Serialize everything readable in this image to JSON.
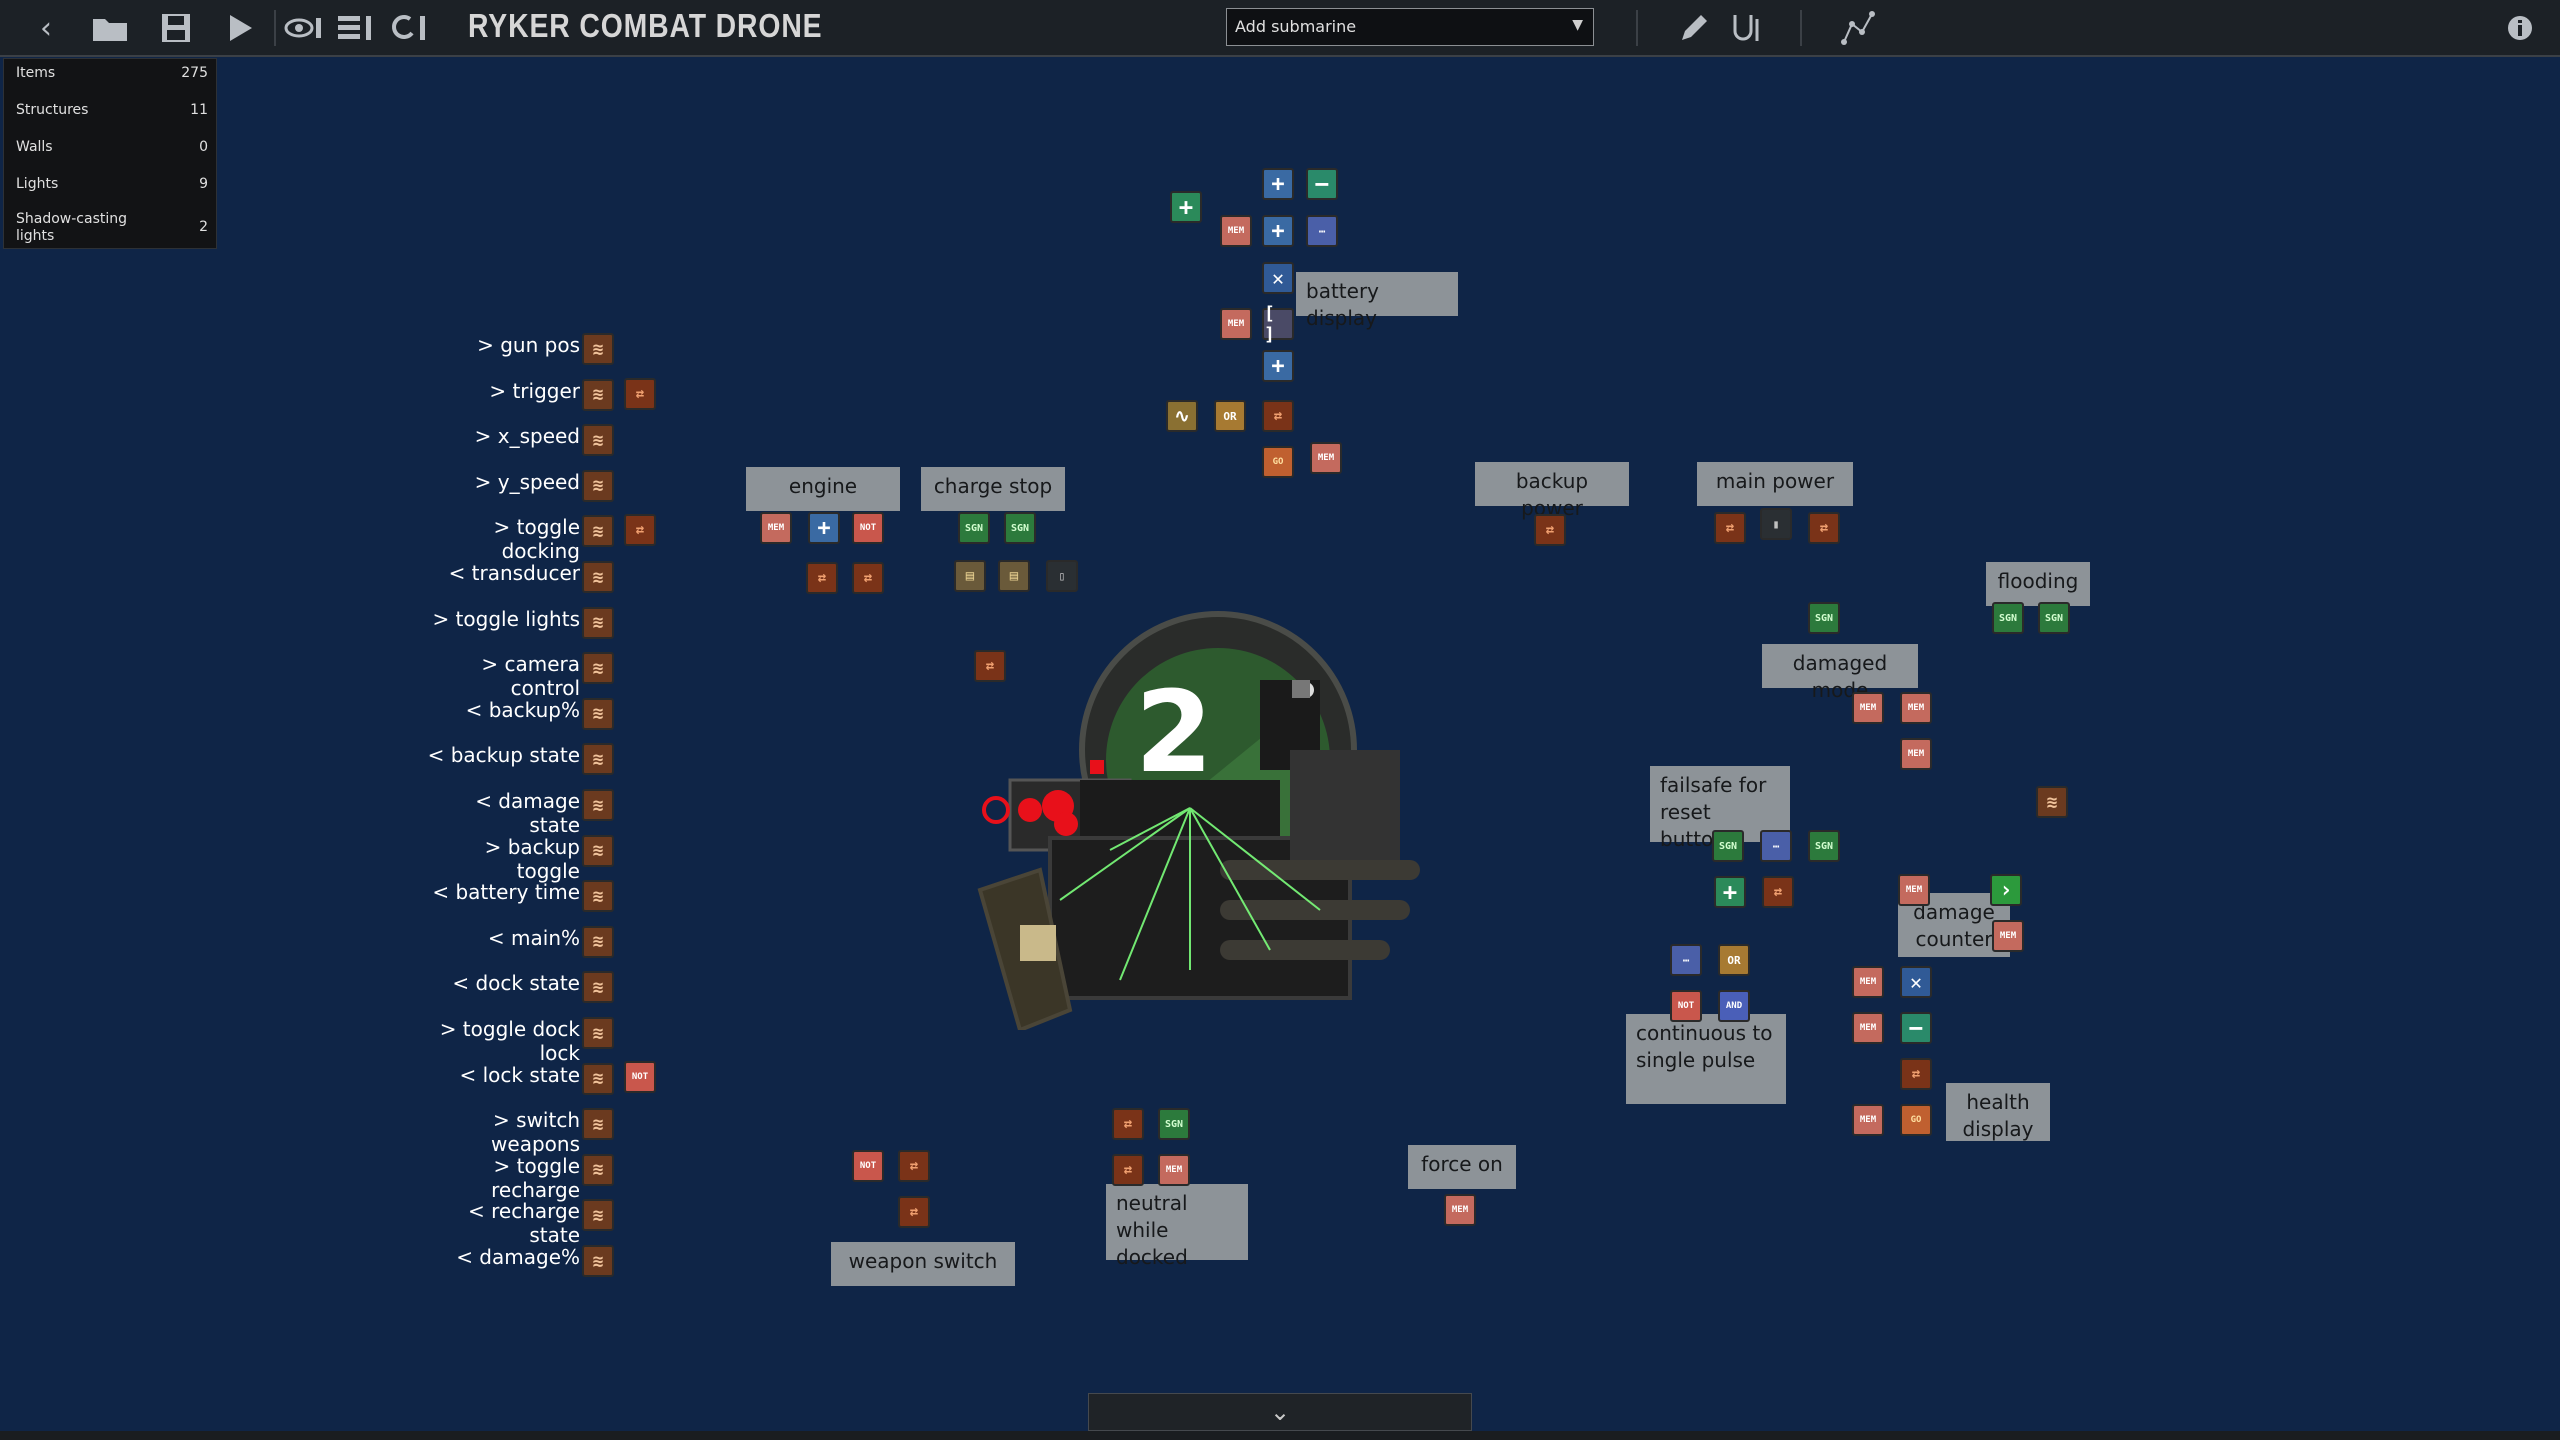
{
  "toolbar": {
    "back_icon": "back-arrow-icon",
    "open_icon": "open-folder-icon",
    "save_icon": "save-icon",
    "test_icon": "play-icon",
    "visibility_icon": "eye-icon",
    "layers_icon": "layers-icon",
    "wiring_icon": "wiring-mode-icon",
    "title": "RYKER COMBAT DRONE",
    "add_submarine": "Add submarine",
    "draw_icon": "pencil-icon",
    "wire_icon": "wire-icon",
    "path_icon": "waypoint-path-icon",
    "info_icon": "info-icon"
  },
  "stats": [
    {
      "label": "Items",
      "value": "275"
    },
    {
      "label": "Structures",
      "value": "11"
    },
    {
      "label": "Walls",
      "value": "0"
    },
    {
      "label": "Lights",
      "value": "9"
    },
    {
      "label": "Shadow-casting lights",
      "value": "2"
    }
  ],
  "signal_labels": [
    "> gun pos",
    "> trigger",
    "> x_speed",
    "> y_speed",
    "> toggle docking",
    "< transducer",
    "> toggle lights",
    "> camera control",
    "< backup%",
    "< backup state",
    "< damage state",
    "> backup toggle",
    "< battery time",
    "< main%",
    "< dock state",
    "> toggle dock lock",
    "< lock state",
    "> switch weapons",
    "> toggle recharge",
    "< recharge state",
    "< damage%"
  ],
  "notes": {
    "battery_display": "battery display",
    "engine": "engine",
    "charge_stop": "charge stop",
    "backup_power": "backup power",
    "main_power": "main power",
    "flooding": "flooding",
    "damaged_mode": "damaged mode",
    "failsafe": "failsafe for reset button",
    "damage_counter": "damage counter",
    "continuous": "continuous to single pulse",
    "health_display": "health display",
    "force_on": "force on",
    "neutral_docked": "neutral while docked",
    "weapon_switch": "weapon switch"
  },
  "component_labels": {
    "mem": "MEM",
    "not": "NOT",
    "sgn": "SGN",
    "or": "OR",
    "and": "AND",
    "go": "GO"
  },
  "submarine": {
    "number": "2",
    "hull_color": "#2d5a2e",
    "laser_color": "#7cff7c",
    "alert_color": "#e8101a"
  },
  "bottom_toggle_icon": "chevron-down-icon",
  "colors": {
    "background": "#0f2547",
    "toolbar": "#1c2126",
    "note": "#8d9398"
  }
}
